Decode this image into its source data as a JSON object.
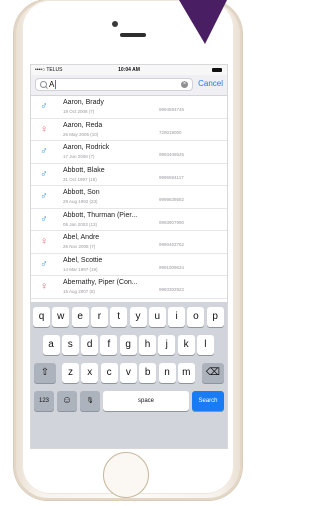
{
  "status": {
    "carrier": "••••○ TELUS",
    "time": "10:04 AM"
  },
  "search": {
    "value": "A",
    "cancel_label": "Cancel",
    "clear_glyph": "×"
  },
  "contacts": [
    {
      "name": "Aaron, Brady",
      "sub": "19 Oct 2008 (7)",
      "number": "9994594745",
      "gender": "male"
    },
    {
      "name": "Aaron, Reda",
      "sub": "26 May 2005 (10)",
      "number": "729019000",
      "gender": "female"
    },
    {
      "name": "Aaron, Rodrick",
      "sub": "17 Jun 2008 (7)",
      "number": "9993406525",
      "gender": "male"
    },
    {
      "name": "Abbott, Blake",
      "sub": "31 Oct 1997 (18)",
      "number": "9996594117",
      "gender": "male"
    },
    {
      "name": "Abbott, Son",
      "sub": "29 Aug 1992 (23)",
      "number": "9999839582",
      "gender": "male"
    },
    {
      "name": "Abbott, Thurman (Pier...",
      "sub": "05 Jan 2003 (13)",
      "number": "9993907990",
      "gender": "male"
    },
    {
      "name": "Abel, Andre",
      "sub": "26 Nov 2008 (7)",
      "number": "9990453762",
      "gender": "female"
    },
    {
      "name": "Abel, Scottie",
      "sub": "14 Mar 1997 (19)",
      "number": "9991009634",
      "gender": "male"
    },
    {
      "name": "Abernathy, Piper (Con...",
      "sub": "15 Aug 2007 (8)",
      "number": "9993302922",
      "gender": "female"
    }
  ],
  "gender_symbols": {
    "male": "♂",
    "female": "♀"
  },
  "keyboard": {
    "row1": [
      "q",
      "w",
      "e",
      "r",
      "t",
      "y",
      "u",
      "i",
      "o",
      "p"
    ],
    "row2": [
      "a",
      "s",
      "d",
      "f",
      "g",
      "h",
      "j",
      "k",
      "l"
    ],
    "row3": [
      "z",
      "x",
      "c",
      "v",
      "b",
      "n",
      "m"
    ],
    "shift": "⇧",
    "delete": "⌫",
    "numbers": "123",
    "emoji": "☺",
    "mic": "🎙",
    "space": "space",
    "search": "Search"
  },
  "colors": {
    "accent": "#1a7cf5",
    "male": "#2f8fe0",
    "female": "#e7596a",
    "ribbon": "#4a1e63"
  }
}
